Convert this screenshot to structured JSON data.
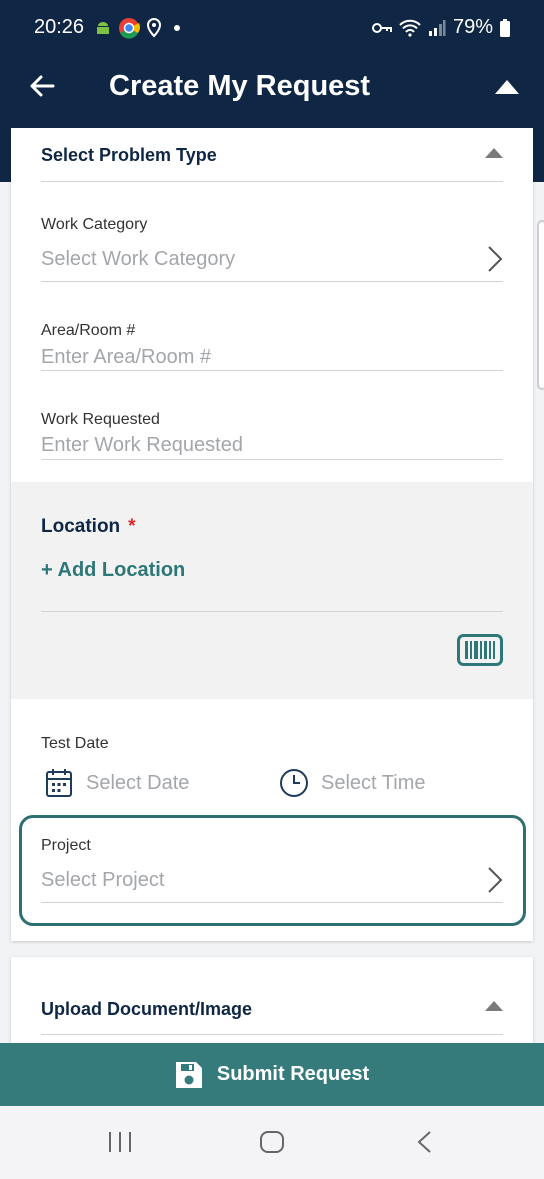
{
  "status_bar": {
    "time": "20:26",
    "battery": "79%",
    "icons": [
      "android-icon",
      "chrome-icon",
      "location-icon",
      "dot-icon",
      "key-icon",
      "wifi-icon",
      "signal-icon",
      "battery-icon"
    ]
  },
  "app_bar": {
    "title": "Create My Request",
    "back_icon": "arrow-left-icon",
    "collapse_icon": "triangle-up-icon"
  },
  "problem_section": {
    "title": "Select Problem Type",
    "work_category": {
      "label": "Work Category",
      "placeholder": "Select Work Category"
    },
    "area_room": {
      "label": "Area/Room #",
      "placeholder": "Enter Area/Room #"
    },
    "work_requested": {
      "label": "Work Requested",
      "placeholder": "Enter Work Requested"
    },
    "location": {
      "label": "Location",
      "required_mark": "*",
      "add_label": "+ Add Location"
    },
    "test_date": {
      "label": "Test Date",
      "date_placeholder": "Select Date",
      "time_placeholder": "Select Time"
    },
    "project": {
      "label": "Project",
      "placeholder": "Select Project"
    }
  },
  "upload_section": {
    "title": "Upload Document/Image"
  },
  "submit": {
    "label": "Submit Request",
    "icon": "save-icon"
  },
  "colors": {
    "header": "#0f2744",
    "accent": "#367b7c",
    "required": "#d62b2b"
  }
}
